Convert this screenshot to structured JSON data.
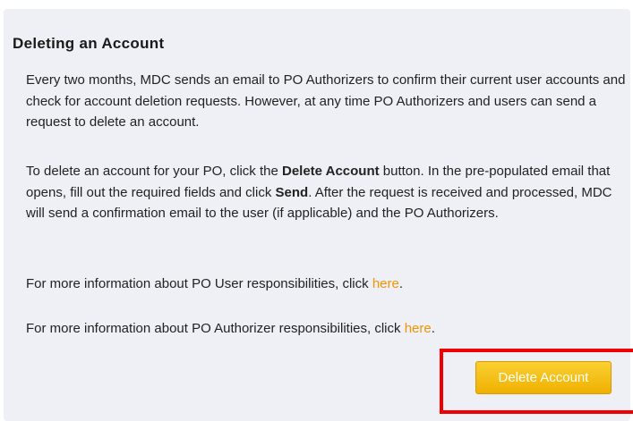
{
  "section": {
    "title": "Deleting an Account",
    "p1": "Every two months, MDC sends an email to PO Authorizers to confirm their current user accounts and check for account deletion requests. However, at any time PO Authorizers and users can send a request to delete an account.",
    "p2_part1": "To delete an account for your PO, click the ",
    "p2_bold1": "Delete Account",
    "p2_part2": " button. In the pre-populated email that opens, fill out the required fields and click ",
    "p2_bold2": "Send",
    "p2_part3": ". After the request is received and processed, MDC will send a confirmation email to the user (if applicable) and the PO Authorizers.",
    "p3_text": "For more information about PO User responsibilities, click ",
    "p3_link": "here",
    "p3_end": ".",
    "p4_text": "For more information about PO Authorizer responsibilities, click ",
    "p4_link": "here",
    "p4_end": "."
  },
  "button": {
    "label": "Delete Account"
  },
  "colors": {
    "panel_bg": "#eff0f6",
    "link": "#f29400",
    "button_top": "#f9d033",
    "button_bottom": "#f0b000",
    "highlight": "#f00000"
  }
}
